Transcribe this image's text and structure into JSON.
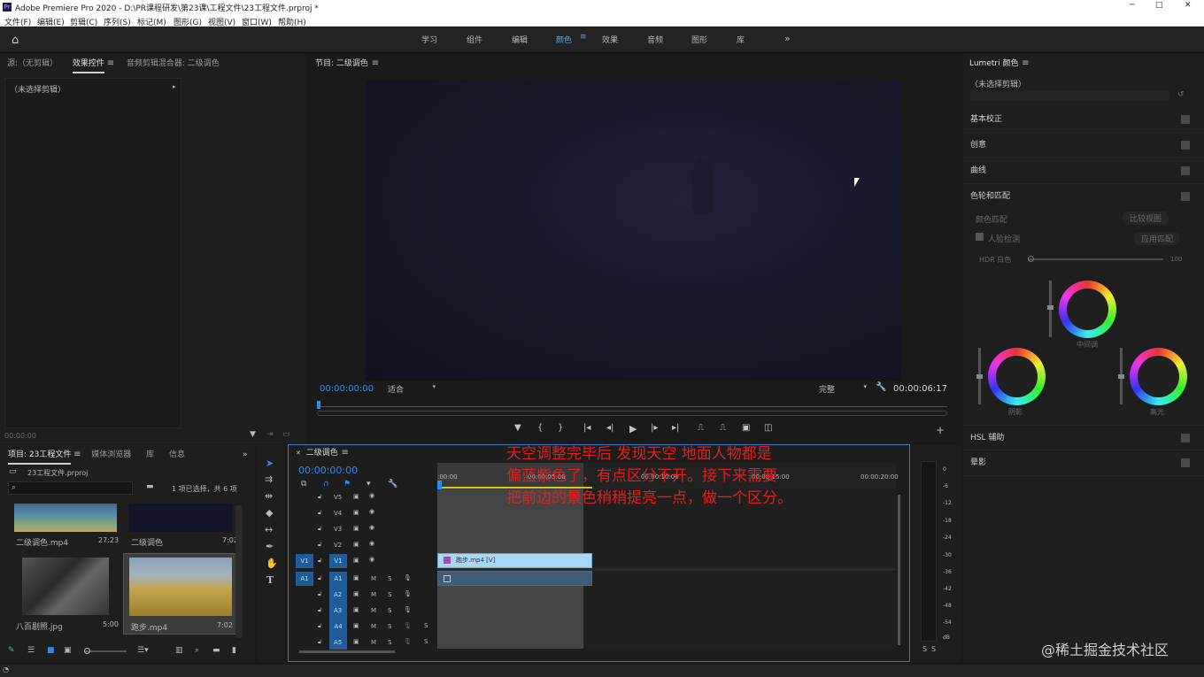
{
  "titlebar": {
    "title": "Adobe Premiere Pro 2020 - D:\\PR课程研发\\第23课\\工程文件\\23工程文件.prproj *"
  },
  "menu": [
    "文件(F)",
    "编辑(E)",
    "剪辑(C)",
    "序列(S)",
    "标记(M)",
    "图形(G)",
    "视图(V)",
    "窗口(W)",
    "帮助(H)"
  ],
  "workspaces": [
    "学习",
    "组件",
    "编辑",
    "颜色",
    "效果",
    "音频",
    "图形",
    "库"
  ],
  "workspace_active": "颜色",
  "source_panel": {
    "tabs": [
      "源:（无剪辑）",
      "效果控件",
      "音频剪辑混合器: 二级调色"
    ],
    "clip_label": "（未选择剪辑）",
    "timecode": "00:00:00"
  },
  "program": {
    "title": "节目: 二级调色",
    "timecode": "00:00:00:00",
    "fit": "适合",
    "quality": "完整",
    "duration": "00:00:06:17"
  },
  "project": {
    "tabs": [
      "项目: 23工程文件",
      "媒体浏览器",
      "库",
      "信息"
    ],
    "file": "23工程文件.prproj",
    "selection": "1 项已选择，共 6 项",
    "items": [
      {
        "name": "二级调色.mp4",
        "duration": "27:23"
      },
      {
        "name": "二级调色",
        "duration": "7:02"
      },
      {
        "name": "八百剧照.jpg",
        "duration": "5:00"
      },
      {
        "name": "跑步.mp4",
        "duration": "7:02"
      }
    ]
  },
  "timeline": {
    "title": "二级调色",
    "timecode": "00:00:00:00",
    "ruler": [
      ":00:00",
      "00:00:05:00",
      "00:00:10:00",
      "00:00:15:00",
      "00:00:20:00"
    ],
    "video_tracks": [
      "V5",
      "V4",
      "V3",
      "V2",
      "V1"
    ],
    "audio_tracks": [
      "A1",
      "A2",
      "A3",
      "A4",
      "A5"
    ],
    "clip_name": "跑步.mp4 [V]",
    "m_label": "M",
    "s_label": "S"
  },
  "meter": {
    "scale": [
      "0",
      "-6",
      "-12",
      "-18",
      "-24",
      "-30",
      "-36",
      "-42",
      "-48",
      "-54",
      "dB"
    ],
    "s_labels": [
      "S",
      "S"
    ]
  },
  "lumetri": {
    "title": "Lumetri 颜色",
    "clip": "（未选择剪辑）",
    "sections": [
      "基本校正",
      "创意",
      "曲线",
      "色轮和匹配"
    ],
    "match_label": "颜色匹配",
    "match_btn": "比较视图",
    "face_label": "人脸检测",
    "apply_btn": "应用匹配",
    "hdr_label": "HDR 白色",
    "hdr_value": "100",
    "wheels": [
      "中间调",
      "阴影",
      "高光"
    ],
    "more_sections": [
      "HSL 辅助",
      "晕影"
    ]
  },
  "annotation": [
    "天空调整完毕后 发现天空 地面人物都是",
    "偏蓝紫色了，有点区分不开。接下来需要",
    "把前边的景色稍稍提亮一点，做一个区分。"
  ],
  "watermark": "@稀土掘金技术社区",
  "colors": {
    "accent": "#2d8ceb",
    "annotation": "#e02020",
    "clip": "#a8d8f5"
  }
}
